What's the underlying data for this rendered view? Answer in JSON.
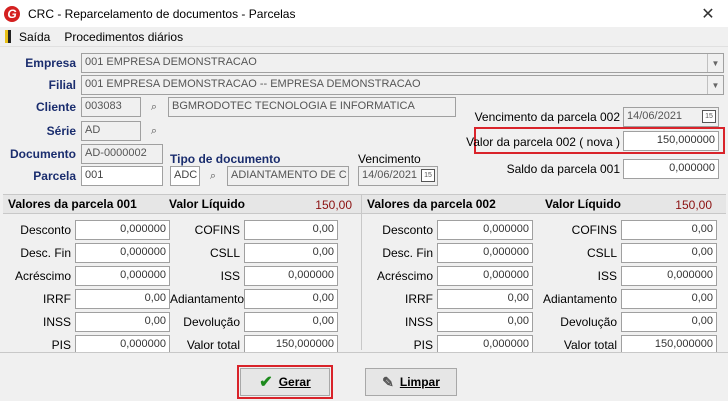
{
  "window": {
    "title": "CRC - Reparcelamento de documentos - Parcelas",
    "close_glyph": "✕"
  },
  "menu": {
    "items": [
      "Saída",
      "Procedimentos diários"
    ]
  },
  "form": {
    "empresa_label": "Empresa",
    "empresa_value": "001 EMPRESA DEMONSTRACAO",
    "filial_label": "Filial",
    "filial_value": "001 EMPRESA DEMONSTRACAO -- EMPRESA DEMONSTRACAO",
    "cliente_label": "Cliente",
    "cliente_code": "003083",
    "cliente_name": "BGMRODOTEC TECNOLOGIA  E INFORMATICA",
    "serie_label": "Série",
    "serie_value": "AD",
    "documento_label": "Documento",
    "documento_value": "AD-0000002",
    "parcela_label": "Parcela",
    "parcela_value": "001",
    "tipo_label": "Tipo de documento",
    "tipo_code": "ADC",
    "tipo_name": "ADIANTAMENTO DE C",
    "vencimento_label": "Vencimento",
    "vencimento_value": "14/06/2021",
    "venc_parcela_label": "Vencimento da parcela 002",
    "venc_parcela_value": "14/06/2021",
    "valor_parcela_label": "Valor da parcela 002 ( nova )",
    "valor_parcela_value": "150,000000",
    "saldo_label": "Saldo da parcela 001",
    "saldo_value": "0,000000"
  },
  "parcela001": {
    "header": "Valores da parcela 001",
    "liquido_label": "Valor Líquido",
    "liquido_value": "150,00",
    "left": [
      {
        "label": "Desconto",
        "value": "0,000000"
      },
      {
        "label": "Desc. Fin",
        "value": "0,000000"
      },
      {
        "label": "Acréscimo",
        "value": "0,000000"
      },
      {
        "label": "IRRF",
        "value": "0,00"
      },
      {
        "label": "INSS",
        "value": "0,00"
      },
      {
        "label": "PIS",
        "value": "0,000000"
      }
    ],
    "right": [
      {
        "label": "COFINS",
        "value": "0,00"
      },
      {
        "label": "CSLL",
        "value": "0,00"
      },
      {
        "label": "ISS",
        "value": "0,000000"
      },
      {
        "label": "Adiantamento",
        "value": "0,00"
      },
      {
        "label": "Devolução",
        "value": "0,00"
      },
      {
        "label": "Valor total",
        "value": "150,000000"
      }
    ]
  },
  "parcela002": {
    "header": "Valores da parcela 002",
    "liquido_label": "Valor Líquido",
    "liquido_value": "150,00",
    "left": [
      {
        "label": "Desconto",
        "value": "0,000000"
      },
      {
        "label": "Desc. Fin",
        "value": "0,000000"
      },
      {
        "label": "Acréscimo",
        "value": "0,000000"
      },
      {
        "label": "IRRF",
        "value": "0,00"
      },
      {
        "label": "INSS",
        "value": "0,00"
      },
      {
        "label": "PIS",
        "value": "0,000000"
      }
    ],
    "right": [
      {
        "label": "COFINS",
        "value": "0,00"
      },
      {
        "label": "CSLL",
        "value": "0,00"
      },
      {
        "label": "ISS",
        "value": "0,000000"
      },
      {
        "label": "Adiantamento",
        "value": "0,00"
      },
      {
        "label": "Devolução",
        "value": "0,00"
      },
      {
        "label": "Valor total",
        "value": "150,000000"
      }
    ]
  },
  "buttons": {
    "gerar": "Gerar",
    "limpar": "Limpar"
  },
  "colors": {
    "label_blue": "#1a2d6e",
    "liquido_red": "#8b1010",
    "highlight_red": "#d9232a"
  }
}
